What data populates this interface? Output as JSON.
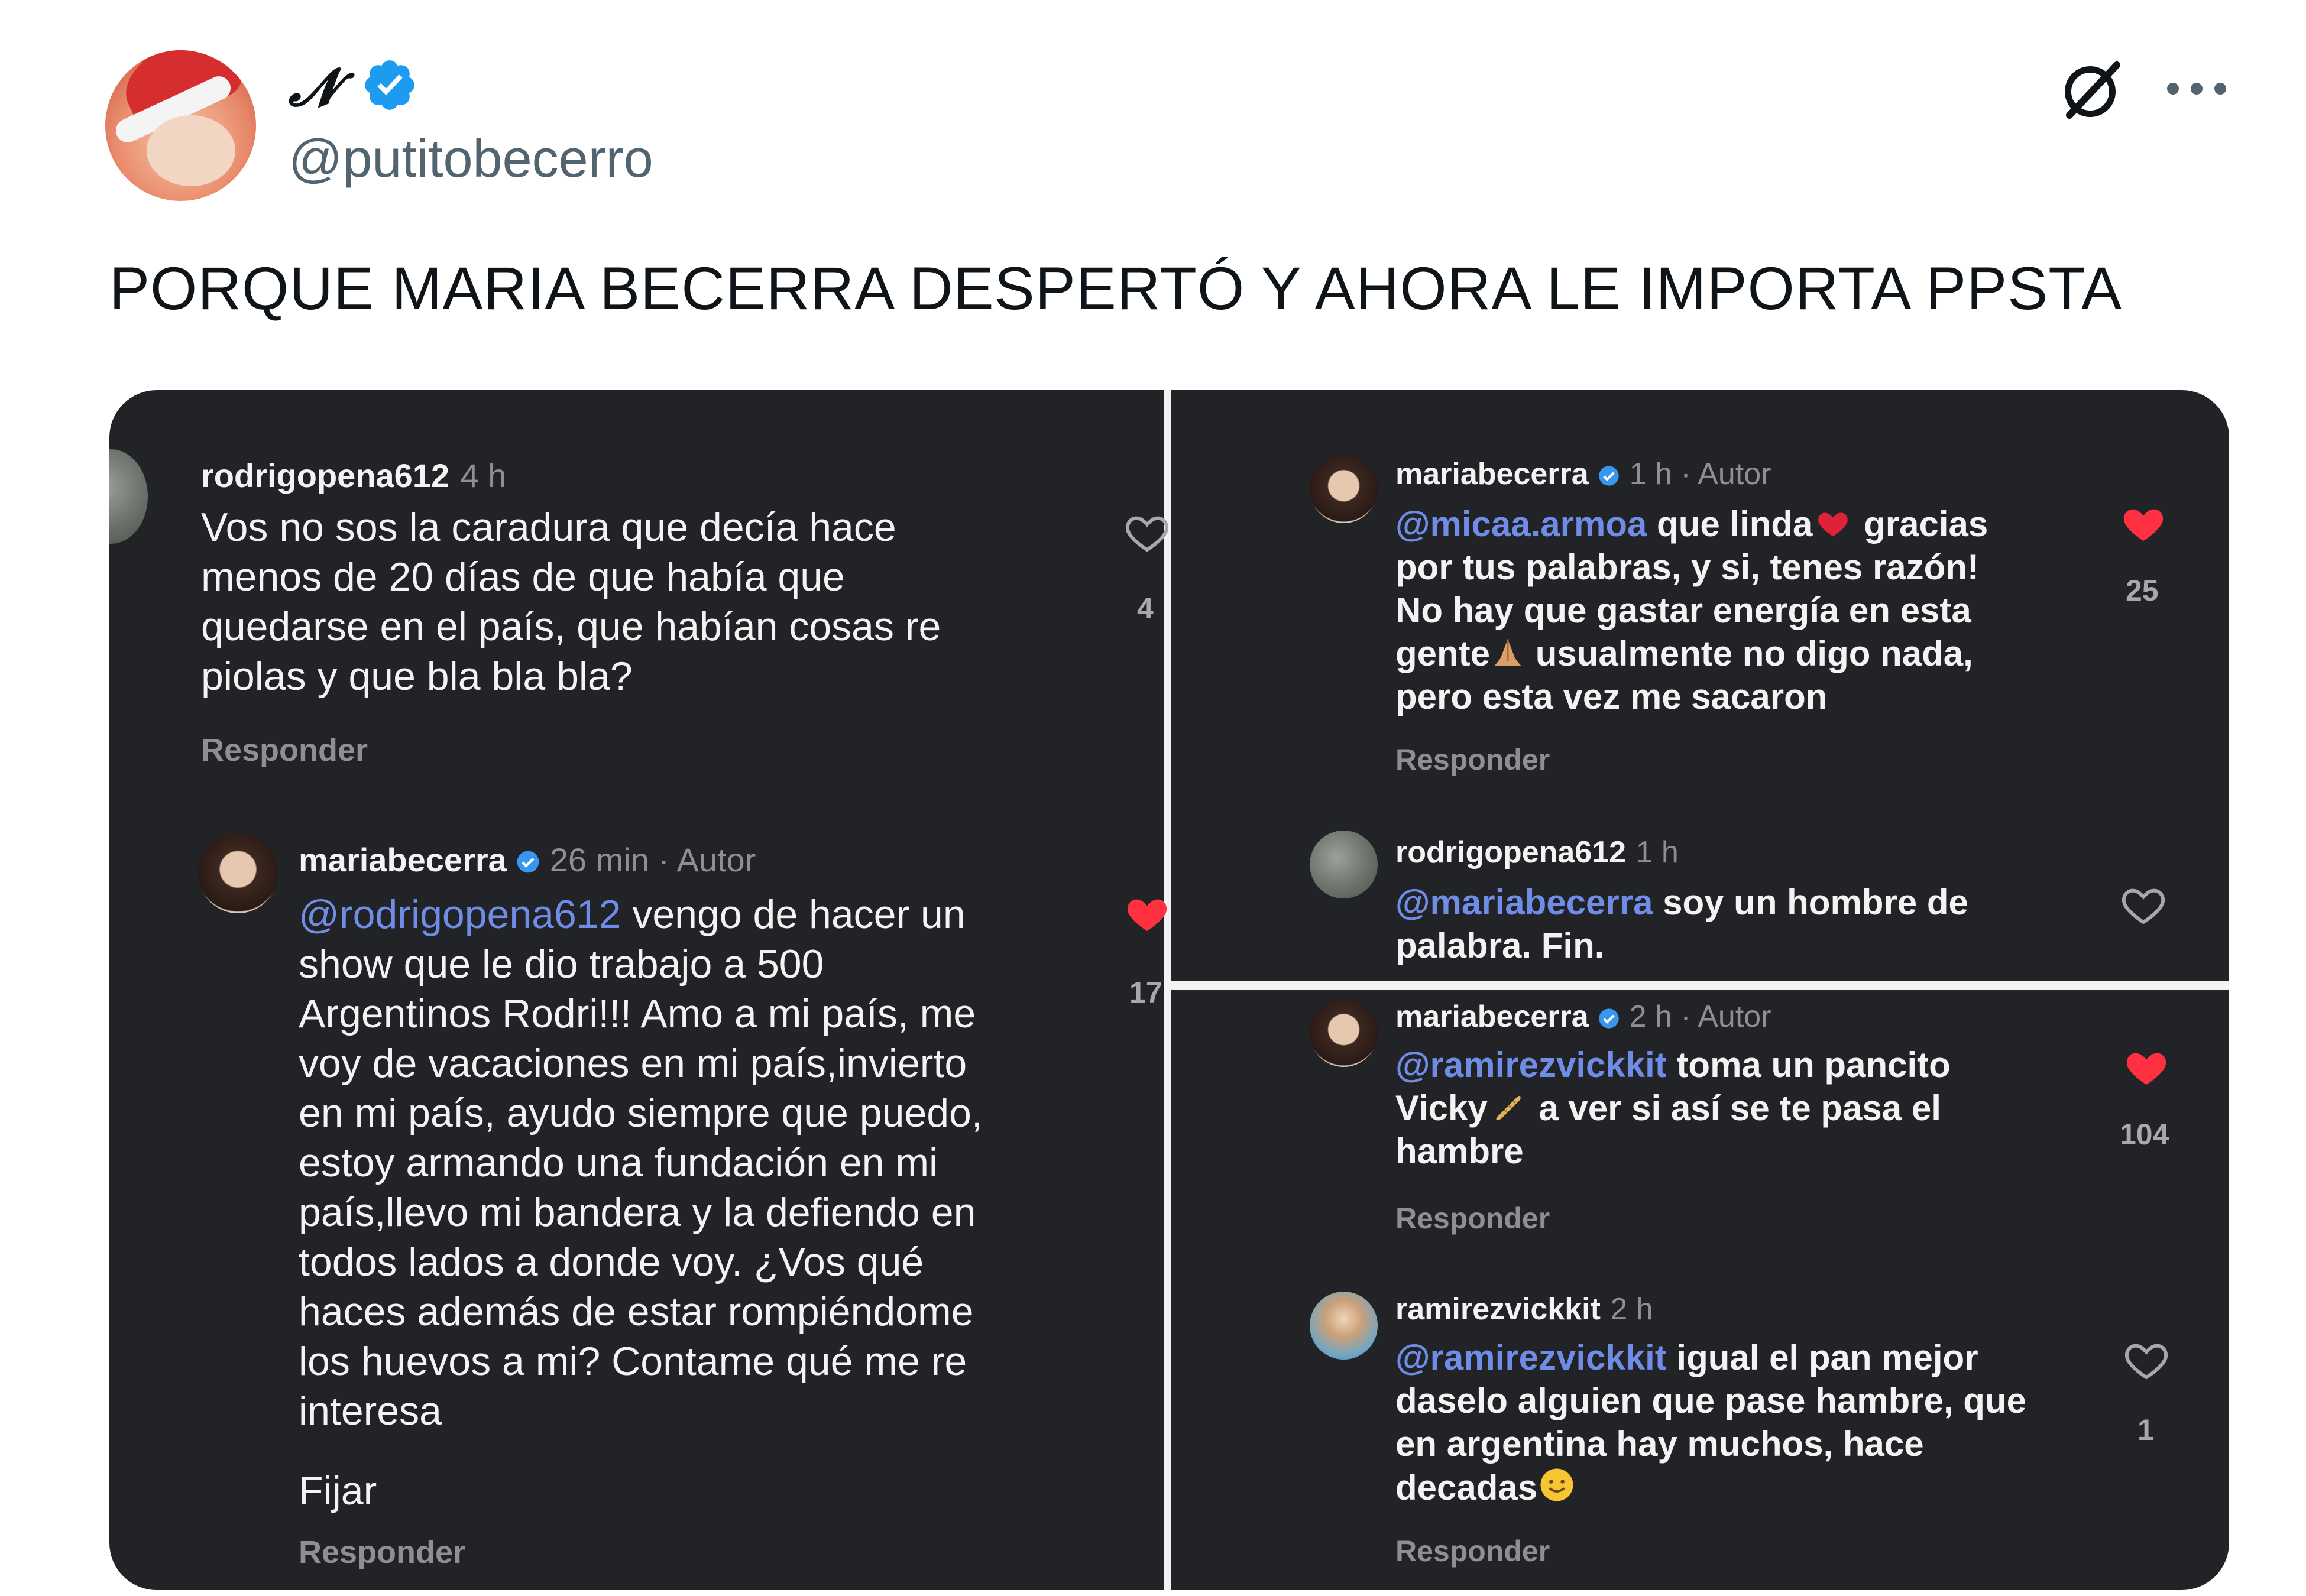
{
  "header": {
    "display_name": "𝓝",
    "handle": "@putitobecerro"
  },
  "tweet": {
    "text": "PORQUE MARIA BECERRA DESPERTÓ Y AHORA LE IMPORTA PPSTA"
  },
  "icons": {
    "verified": "verified-badge-icon",
    "grok": "grok-icon",
    "more": "more-options-icon",
    "heart": "heart-icon"
  },
  "colors": {
    "verified_blue": "#1d9bf0",
    "mention_blue": "#6f8ce6",
    "heart_red": "#ff3040",
    "panel_bg": "#222327"
  },
  "panel_left": {
    "comment1": {
      "username": "rodrigopena612",
      "time": "4 h",
      "lines": [
        "Vos no sos la caradura que decía hace",
        "menos de 20 días de que había que",
        "quedarse en el país, que habían cosas re",
        "piolas y que bla bla bla?"
      ],
      "likes": "4",
      "reply": "Responder"
    },
    "comment2": {
      "username": "mariabecerra",
      "time": "26 min · Autor",
      "mention": "@rodrigopena612",
      "line1_rest": " vengo de hacer un",
      "lines": [
        "show que le dio trabajo a 500",
        "Argentinos Rodri!!! Amo a mi país, me",
        "voy de vacaciones en mi país,invierto",
        "en mi país, ayudo siempre que puedo,",
        "estoy armando una fundación en mi",
        "país,llevo mi bandera y la defiendo en",
        "todos lados a donde voy. ¿Vos qué",
        "haces además de estar rompiéndome",
        "los huevos a mi? Contame qué me re",
        "interesa"
      ],
      "likes": "17",
      "pin": "Fijar",
      "reply": "Responder"
    }
  },
  "panel_top_right": {
    "comment1": {
      "username": "mariabecerra",
      "time": "1 h · Autor",
      "mention": "@micaa.armoa",
      "line1_rest": " que linda",
      "line1_end": " gracias",
      "lines": [
        "por tus palabras, y si, tenes razón!",
        "No hay que gastar energía en esta"
      ],
      "line4_start": "gente",
      "line4_end": " usualmente no digo nada,",
      "line5": "pero esta vez me sacaron",
      "likes": "25",
      "reply": "Responder"
    },
    "comment2": {
      "username": "rodrigopena612",
      "time": "1 h",
      "mention": "@mariabecerra",
      "line1_rest": " soy un hombre de",
      "line2": "palabra. Fin."
    }
  },
  "panel_bottom_right": {
    "comment1": {
      "username": "mariabecerra",
      "time": "2 h · Autor",
      "mention": "@ramirezvickkit",
      "line1_rest": " toma un pancito",
      "line2_start": "Vicky",
      "line2_end": " a ver si así se te pasa el",
      "line3": "hambre",
      "likes": "104",
      "reply": "Responder"
    },
    "comment2": {
      "username": "ramirezvickkit",
      "time": "2 h",
      "mention": "@ramirezvickkit",
      "line1_rest": " igual el pan mejor",
      "lines": [
        "daselo alguien que pase hambre, que",
        "en argentina hay muchos, hace"
      ],
      "line4": "decadas",
      "likes": "1",
      "reply": "Responder"
    }
  }
}
